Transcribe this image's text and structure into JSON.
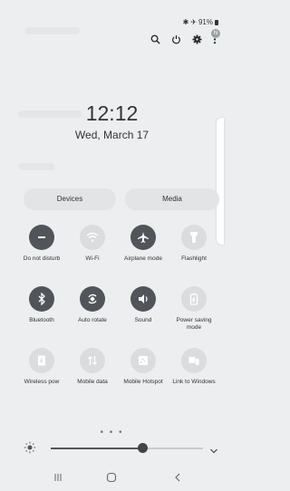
{
  "status": {
    "battery_text": "91%"
  },
  "clock": {
    "time": "12:12",
    "date": "Wed, March 17"
  },
  "panels": {
    "devices": "Devices",
    "media": "Media"
  },
  "tiles": [
    {
      "label": "Do not disturb",
      "icon": "minus-circle-icon",
      "state": "on"
    },
    {
      "label": "Wi-Fi",
      "icon": "wifi-icon",
      "state": "off"
    },
    {
      "label": "Airplane mode",
      "icon": "airplane-icon",
      "state": "on"
    },
    {
      "label": "Flashlight",
      "icon": "flashlight-icon",
      "state": "off"
    },
    {
      "label": "Bluetooth",
      "icon": "bluetooth-icon",
      "state": "on"
    },
    {
      "label": "Auto rotate",
      "icon": "auto-rotate-icon",
      "state": "on"
    },
    {
      "label": "Sound",
      "icon": "sound-icon",
      "state": "on"
    },
    {
      "label": "Power saving mode",
      "icon": "power-saving-icon",
      "state": "off"
    },
    {
      "label": "Wireless pow",
      "icon": "wireless-powershare-icon",
      "state": "off"
    },
    {
      "label": "Mobile data",
      "icon": "mobile-data-icon",
      "state": "off"
    },
    {
      "label": "Mobile Hotspot",
      "icon": "hotspot-icon",
      "state": "off"
    },
    {
      "label": "Link to Windows",
      "icon": "link-to-windows-icon",
      "state": "off"
    }
  ],
  "page_indicator": "• • •",
  "brightness": {
    "level": 0.6
  },
  "colors": {
    "active_tile": "#515559",
    "inactive_tile": "#dadcdd",
    "background": "#eceeef"
  }
}
